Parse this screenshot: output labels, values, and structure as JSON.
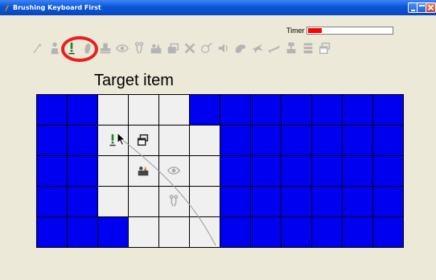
{
  "window": {
    "title": "Brushing Keyboard First"
  },
  "timer": {
    "label": "Timer",
    "progress": 0.16,
    "fill_color": "#ff0000"
  },
  "target": {
    "label": "Target item",
    "icon": "exclamation-person-icon",
    "highlight_color": "#e8201e"
  },
  "toolbar": {
    "icons": [
      "wand-icon",
      "person-icon",
      "exclamation-person-icon",
      "hand-icon",
      "stamp-icon",
      "eye-icon",
      "figure-icon",
      "scene-icon",
      "pages-icon",
      "x-icon",
      "brush-icon",
      "speaker-icon",
      "palette-icon",
      "plane-icon",
      "pen-icon",
      "lamp-icon",
      "stack-icon",
      "windows-icon"
    ]
  },
  "grid": {
    "rows": 5,
    "cols": 12,
    "blue_color": "#0000f0",
    "white_color": "#f0f0f0",
    "white_cells": [
      [
        0,
        2
      ],
      [
        0,
        3
      ],
      [
        0,
        4
      ],
      [
        1,
        2
      ],
      [
        1,
        3
      ],
      [
        1,
        4
      ],
      [
        1,
        5
      ],
      [
        2,
        2
      ],
      [
        2,
        3
      ],
      [
        2,
        4
      ],
      [
        2,
        5
      ],
      [
        3,
        2
      ],
      [
        3,
        3
      ],
      [
        3,
        4
      ],
      [
        3,
        5
      ],
      [
        4,
        3
      ],
      [
        4,
        4
      ],
      [
        4,
        5
      ]
    ],
    "items": [
      {
        "row": 1,
        "col": 2,
        "icon": "exclamation-person-icon"
      },
      {
        "row": 1,
        "col": 3,
        "icon": "windows-icon"
      },
      {
        "row": 2,
        "col": 3,
        "icon": "scene-icon"
      },
      {
        "row": 2,
        "col": 4,
        "icon": "eye-icon"
      },
      {
        "row": 3,
        "col": 4,
        "icon": "figure-icon"
      }
    ]
  }
}
